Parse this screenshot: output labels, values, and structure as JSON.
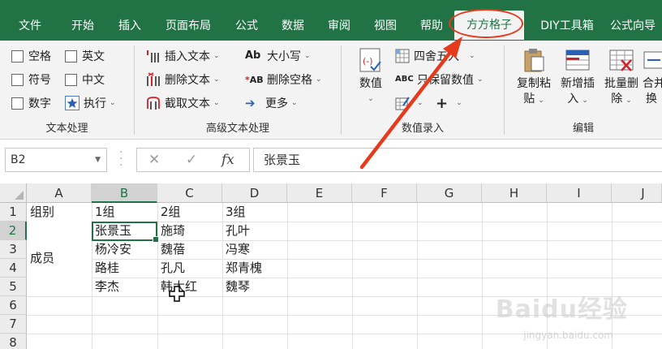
{
  "tabs": [
    {
      "label": "文件"
    },
    {
      "label": "开始"
    },
    {
      "label": "插入"
    },
    {
      "label": "页面布局"
    },
    {
      "label": "公式"
    },
    {
      "label": "数据"
    },
    {
      "label": "审阅"
    },
    {
      "label": "视图"
    },
    {
      "label": "帮助"
    },
    {
      "label": "方方格子",
      "active": true
    },
    {
      "label": "DIY工具箱"
    },
    {
      "label": "公式向导"
    }
  ],
  "ribbon": {
    "text_group": {
      "label": "文本处理",
      "checks": [
        "空格",
        "英文",
        "符号",
        "中文",
        "数字"
      ],
      "execute": "执行"
    },
    "advanced_group": {
      "label": "高级文本处理",
      "insert_text": "插入文本",
      "delete_text": "删除文本",
      "extract_text": "截取文本",
      "case": "大小写",
      "delete_space": "删除空格",
      "more": "更多"
    },
    "number_group": {
      "label": "数值录入",
      "value_btn": "数值",
      "round": "四舍五入",
      "keep_value": "只保留数值",
      "plus": "+"
    },
    "edit_group": {
      "label": "编辑",
      "copy_paste": [
        "复制粘",
        "贴"
      ],
      "add_insert": [
        "新增插",
        "入"
      ],
      "batch_delete": [
        "批量删",
        "除"
      ],
      "merge_swap": [
        "合并",
        "换"
      ]
    }
  },
  "formula_bar": {
    "name_box": "B2",
    "cancel": "✕",
    "confirm": "✓",
    "fx": "fx",
    "value": "张景玉"
  },
  "sheet": {
    "columns": [
      "A",
      "B",
      "C",
      "D",
      "E",
      "F",
      "G",
      "H",
      "I",
      "J"
    ],
    "rows": [
      "1",
      "2",
      "3",
      "4",
      "5",
      "6",
      "7",
      "8"
    ],
    "a1": "组别",
    "merged_a": "成员",
    "header_row": [
      "1组",
      "2组",
      "3组"
    ],
    "data": [
      [
        "张景玉",
        "施琦",
        "孔叶"
      ],
      [
        "杨冷安",
        "魏蓓",
        "冯寒"
      ],
      [
        "路桂",
        "孔凡",
        "郑青槐"
      ],
      [
        "李杰",
        "韩太红",
        "魏琴"
      ]
    ]
  },
  "watermark": {
    "brand": "Baidu经验",
    "url": "jingyan.baidu.com"
  }
}
